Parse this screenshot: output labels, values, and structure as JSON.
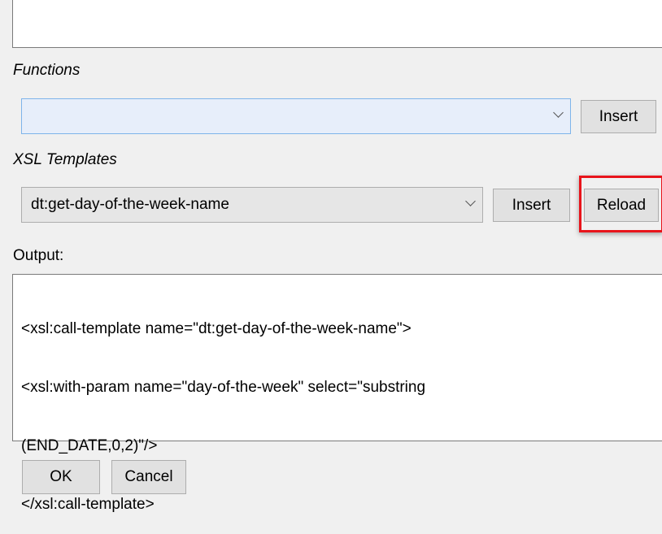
{
  "functions": {
    "label": "Functions",
    "selected": "",
    "insert_label": "Insert"
  },
  "xsl_templates": {
    "label": "XSL Templates",
    "selected": "dt:get-day-of-the-week-name",
    "insert_label": "Insert",
    "reload_label": "Reload"
  },
  "output": {
    "label": "Output:",
    "lines": [
      "<xsl:call-template name=\"dt:get-day-of-the-week-name\">",
      "<xsl:with-param name=\"day-of-the-week\" select=\"substring",
      "(END_DATE,0,2)\"/>",
      "</xsl:call-template>"
    ]
  },
  "footer": {
    "ok_label": "OK",
    "cancel_label": "Cancel"
  }
}
